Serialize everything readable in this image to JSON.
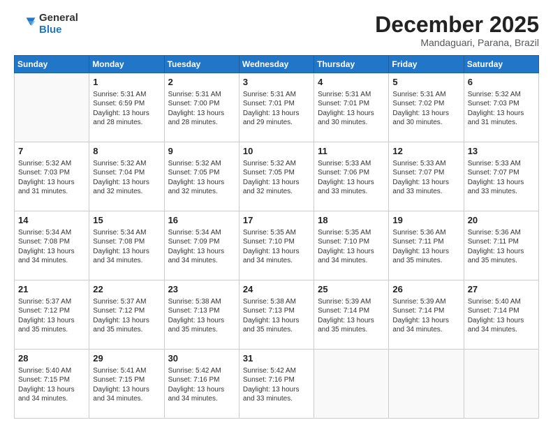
{
  "logo": {
    "general": "General",
    "blue": "Blue"
  },
  "header": {
    "month": "December 2025",
    "location": "Mandaguari, Parana, Brazil"
  },
  "weekdays": [
    "Sunday",
    "Monday",
    "Tuesday",
    "Wednesday",
    "Thursday",
    "Friday",
    "Saturday"
  ],
  "weeks": [
    [
      {
        "day": "",
        "info": ""
      },
      {
        "day": "1",
        "info": "Sunrise: 5:31 AM\nSunset: 6:59 PM\nDaylight: 13 hours\nand 28 minutes."
      },
      {
        "day": "2",
        "info": "Sunrise: 5:31 AM\nSunset: 7:00 PM\nDaylight: 13 hours\nand 28 minutes."
      },
      {
        "day": "3",
        "info": "Sunrise: 5:31 AM\nSunset: 7:01 PM\nDaylight: 13 hours\nand 29 minutes."
      },
      {
        "day": "4",
        "info": "Sunrise: 5:31 AM\nSunset: 7:01 PM\nDaylight: 13 hours\nand 30 minutes."
      },
      {
        "day": "5",
        "info": "Sunrise: 5:31 AM\nSunset: 7:02 PM\nDaylight: 13 hours\nand 30 minutes."
      },
      {
        "day": "6",
        "info": "Sunrise: 5:32 AM\nSunset: 7:03 PM\nDaylight: 13 hours\nand 31 minutes."
      }
    ],
    [
      {
        "day": "7",
        "info": "Sunrise: 5:32 AM\nSunset: 7:03 PM\nDaylight: 13 hours\nand 31 minutes."
      },
      {
        "day": "8",
        "info": "Sunrise: 5:32 AM\nSunset: 7:04 PM\nDaylight: 13 hours\nand 32 minutes."
      },
      {
        "day": "9",
        "info": "Sunrise: 5:32 AM\nSunset: 7:05 PM\nDaylight: 13 hours\nand 32 minutes."
      },
      {
        "day": "10",
        "info": "Sunrise: 5:32 AM\nSunset: 7:05 PM\nDaylight: 13 hours\nand 32 minutes."
      },
      {
        "day": "11",
        "info": "Sunrise: 5:33 AM\nSunset: 7:06 PM\nDaylight: 13 hours\nand 33 minutes."
      },
      {
        "day": "12",
        "info": "Sunrise: 5:33 AM\nSunset: 7:07 PM\nDaylight: 13 hours\nand 33 minutes."
      },
      {
        "day": "13",
        "info": "Sunrise: 5:33 AM\nSunset: 7:07 PM\nDaylight: 13 hours\nand 33 minutes."
      }
    ],
    [
      {
        "day": "14",
        "info": "Sunrise: 5:34 AM\nSunset: 7:08 PM\nDaylight: 13 hours\nand 34 minutes."
      },
      {
        "day": "15",
        "info": "Sunrise: 5:34 AM\nSunset: 7:08 PM\nDaylight: 13 hours\nand 34 minutes."
      },
      {
        "day": "16",
        "info": "Sunrise: 5:34 AM\nSunset: 7:09 PM\nDaylight: 13 hours\nand 34 minutes."
      },
      {
        "day": "17",
        "info": "Sunrise: 5:35 AM\nSunset: 7:10 PM\nDaylight: 13 hours\nand 34 minutes."
      },
      {
        "day": "18",
        "info": "Sunrise: 5:35 AM\nSunset: 7:10 PM\nDaylight: 13 hours\nand 34 minutes."
      },
      {
        "day": "19",
        "info": "Sunrise: 5:36 AM\nSunset: 7:11 PM\nDaylight: 13 hours\nand 35 minutes."
      },
      {
        "day": "20",
        "info": "Sunrise: 5:36 AM\nSunset: 7:11 PM\nDaylight: 13 hours\nand 35 minutes."
      }
    ],
    [
      {
        "day": "21",
        "info": "Sunrise: 5:37 AM\nSunset: 7:12 PM\nDaylight: 13 hours\nand 35 minutes."
      },
      {
        "day": "22",
        "info": "Sunrise: 5:37 AM\nSunset: 7:12 PM\nDaylight: 13 hours\nand 35 minutes."
      },
      {
        "day": "23",
        "info": "Sunrise: 5:38 AM\nSunset: 7:13 PM\nDaylight: 13 hours\nand 35 minutes."
      },
      {
        "day": "24",
        "info": "Sunrise: 5:38 AM\nSunset: 7:13 PM\nDaylight: 13 hours\nand 35 minutes."
      },
      {
        "day": "25",
        "info": "Sunrise: 5:39 AM\nSunset: 7:14 PM\nDaylight: 13 hours\nand 35 minutes."
      },
      {
        "day": "26",
        "info": "Sunrise: 5:39 AM\nSunset: 7:14 PM\nDaylight: 13 hours\nand 34 minutes."
      },
      {
        "day": "27",
        "info": "Sunrise: 5:40 AM\nSunset: 7:14 PM\nDaylight: 13 hours\nand 34 minutes."
      }
    ],
    [
      {
        "day": "28",
        "info": "Sunrise: 5:40 AM\nSunset: 7:15 PM\nDaylight: 13 hours\nand 34 minutes."
      },
      {
        "day": "29",
        "info": "Sunrise: 5:41 AM\nSunset: 7:15 PM\nDaylight: 13 hours\nand 34 minutes."
      },
      {
        "day": "30",
        "info": "Sunrise: 5:42 AM\nSunset: 7:16 PM\nDaylight: 13 hours\nand 34 minutes."
      },
      {
        "day": "31",
        "info": "Sunrise: 5:42 AM\nSunset: 7:16 PM\nDaylight: 13 hours\nand 33 minutes."
      },
      {
        "day": "",
        "info": ""
      },
      {
        "day": "",
        "info": ""
      },
      {
        "day": "",
        "info": ""
      }
    ]
  ]
}
